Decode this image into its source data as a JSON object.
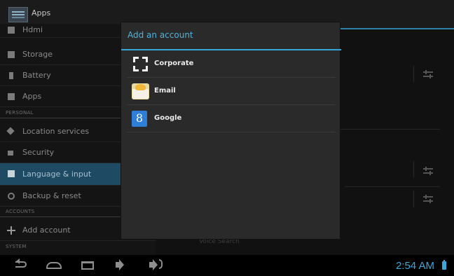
{
  "actionbar": {
    "title": "Apps",
    "icon": "settings-app-icon"
  },
  "left_list": {
    "items": [
      {
        "label": "Hdmi",
        "icon": "hdmi-icon"
      },
      {
        "label": "Storage",
        "icon": "storage-icon"
      },
      {
        "label": "Battery",
        "icon": "battery-icon"
      },
      {
        "label": "Apps",
        "icon": "apps-icon"
      },
      {
        "label": "Location services",
        "icon": "location-icon"
      },
      {
        "label": "Security",
        "icon": "lock-icon"
      },
      {
        "label": "Language & input",
        "icon": "language-icon",
        "selected": true
      },
      {
        "label": "Backup & reset",
        "icon": "backup-icon"
      },
      {
        "label": "Add account",
        "icon": "plus-icon"
      }
    ],
    "headers": {
      "personal": "PERSONAL",
      "accounts": "ACCOUNTS",
      "system": "SYSTEM"
    }
  },
  "right_pane": {
    "voice_search": "Voice Search"
  },
  "dialog": {
    "title": "Add an account",
    "accounts": [
      {
        "label": "Corporate",
        "icon": "corporate-icon"
      },
      {
        "label": "Email",
        "icon": "email-icon"
      },
      {
        "label": "Google",
        "icon": "google-icon",
        "glyph": "8"
      }
    ]
  },
  "navbar": {
    "time": "2:54 AM"
  },
  "colors": {
    "accent": "#37a6d6",
    "selected_row": "#1e4a64",
    "dialog_bg": "#2a2a2a"
  }
}
